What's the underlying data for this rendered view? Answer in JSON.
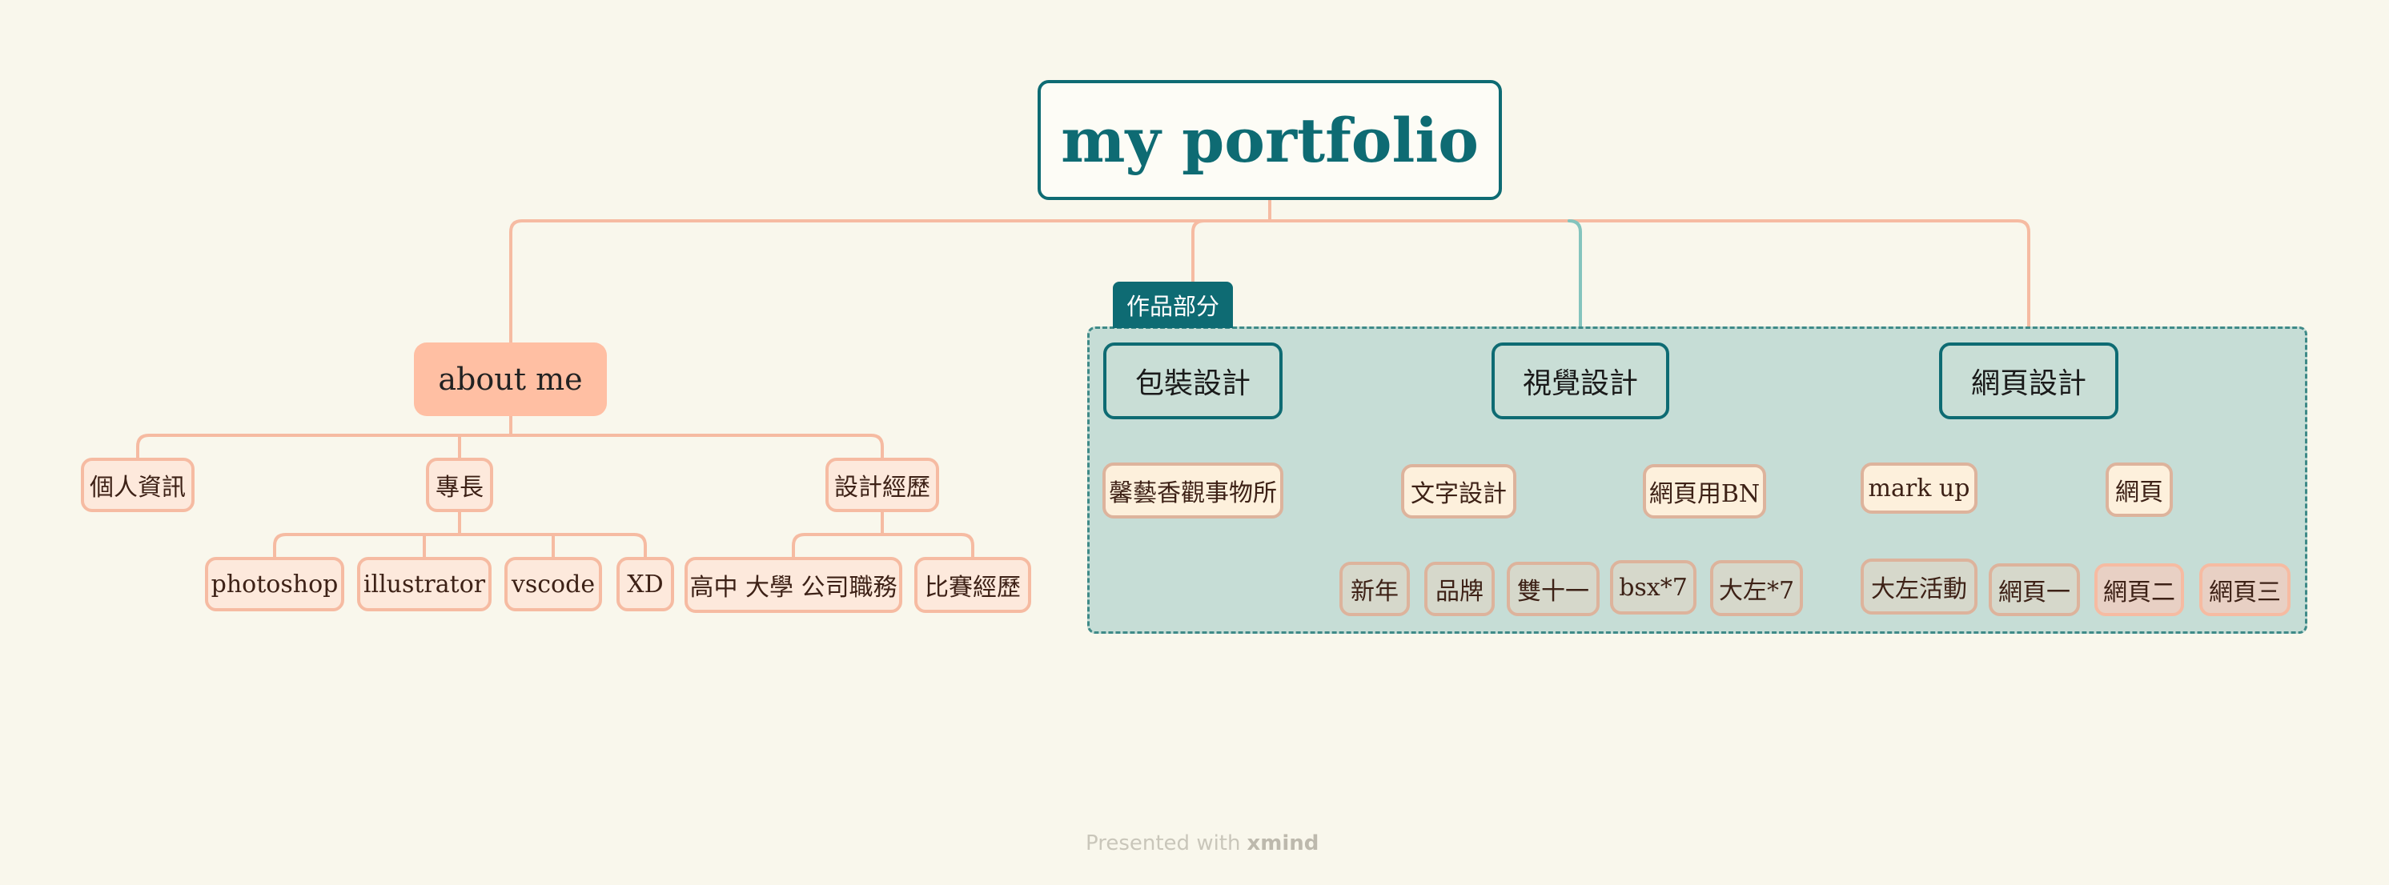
{
  "root": {
    "title": "my portfolio"
  },
  "about": {
    "label": "about me",
    "children": [
      {
        "label": "個人資訊"
      },
      {
        "label": "專長",
        "children": [
          "photoshop",
          "illustrator",
          "vscode",
          "XD"
        ]
      },
      {
        "label": "設計經歷",
        "children": [
          "高中 大學 公司職務",
          "比賽經歷"
        ]
      }
    ]
  },
  "works": {
    "boundary_label": "作品部分",
    "packaging": {
      "label": "包裝設計",
      "children": [
        "馨藝香觀事物所"
      ]
    },
    "visual": {
      "label": "視覺設計",
      "text_design": {
        "label": "文字設計",
        "children": [
          "新年",
          "品牌",
          "雙十一"
        ]
      },
      "web_banner": {
        "label": "網頁用BN",
        "children": [
          "bsx*7",
          "大左*7"
        ]
      }
    },
    "web": {
      "label": "網頁設計",
      "markup": {
        "label": "mark up",
        "children": [
          "大左活動"
        ]
      },
      "pages": {
        "label": "網頁",
        "children": [
          "網頁一",
          "網頁二",
          "網頁三"
        ]
      }
    }
  },
  "footer": {
    "prefix": "Presented with",
    "brand": "xmind"
  },
  "colors": {
    "background": "#f9f7ec",
    "teal": "#0e6b73",
    "salmon": "#ffbfa3",
    "boundary_fill": "#c6ddd6",
    "connector_salmon": "#f6bba2",
    "connector_teal": "#84c4bd"
  }
}
